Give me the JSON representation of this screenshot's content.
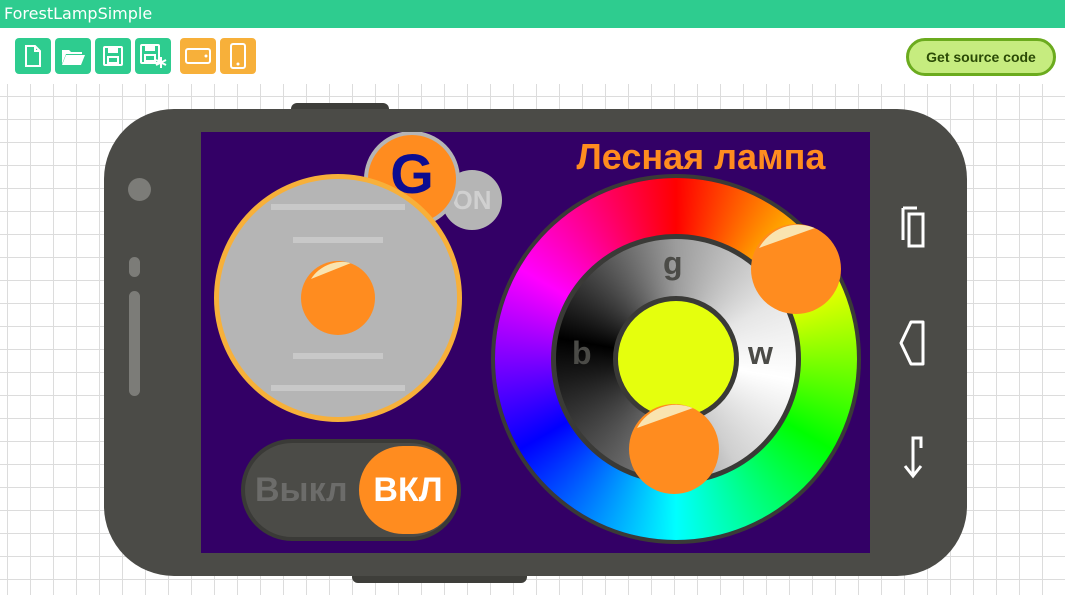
{
  "app": {
    "title": "ForestLampSimple"
  },
  "toolbar": {
    "buttons": [
      {
        "icon": "new-file-icon"
      },
      {
        "icon": "open-folder-icon"
      },
      {
        "icon": "save-icon"
      },
      {
        "icon": "save-as-icon"
      },
      {
        "icon": "landscape-orientation-icon"
      },
      {
        "icon": "portrait-orientation-icon"
      }
    ],
    "source_label": "Get source code"
  },
  "phone_screen": {
    "title": "Лесная лампа",
    "mode_button": {
      "label": "G",
      "back_label": "ON"
    },
    "power_toggle": {
      "off_label": "Выкл",
      "on_label": "ВКЛ",
      "state": "on"
    },
    "color_wheel": {
      "ring_labels": {
        "top": "g",
        "left": "b",
        "right": "w"
      }
    },
    "colors": {
      "accent": "#ff8c1f",
      "screen_bg": "#330066",
      "center_color": "#e5ff0d",
      "frame": "#4b4b47",
      "knob_border": "#f7b03a"
    }
  },
  "colors": {
    "titlebar": "#2ecc8f",
    "file_buttons": "#2ecc8f",
    "orientation_buttons": "#f7b03a",
    "source_button": "#c6ec7f"
  }
}
